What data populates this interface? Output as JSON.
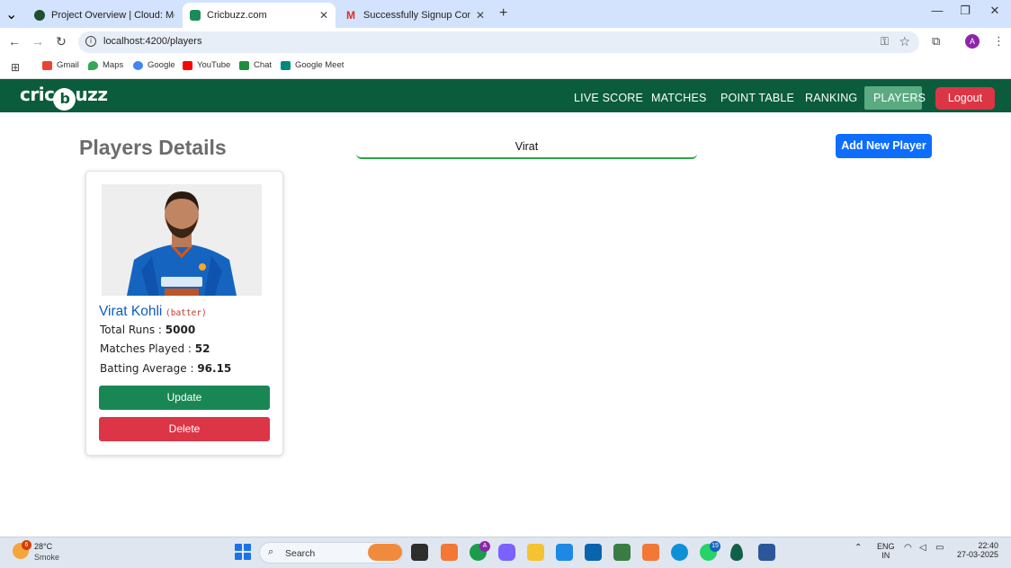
{
  "browser": {
    "tabs": [
      {
        "title": "Project Overview | Cloud: Mong",
        "favicon_color": "#1e4f2f"
      },
      {
        "title": "Cricbuzz.com",
        "favicon_color": "#1b8a5a"
      },
      {
        "title": "Successfully Signup Confirmatio",
        "favicon_color": "#d93025"
      }
    ],
    "url": "localhost:4200/players",
    "bookmarks": [
      "Gmail",
      "Maps",
      "Google",
      "YouTube",
      "Chat",
      "Google Meet"
    ],
    "profile_initial": "A"
  },
  "site": {
    "logo_prefix": "cric",
    "logo_ball": "b",
    "logo_suffix": "uzz",
    "nav": [
      "LIVE SCORE",
      "MATCHES",
      "POINT TABLE",
      "RANKING",
      "PLAYERS"
    ],
    "active_nav": "PLAYERS",
    "logout_label": "Logout",
    "brand_color": "#0b5c3d"
  },
  "page": {
    "title": "Players Details",
    "search_value": "Virat",
    "add_button": "Add New Player"
  },
  "player": {
    "name": "Virat Kohli",
    "role": "(batter)",
    "runs_label": "Total Runs : ",
    "runs_value": "5000",
    "matches_label": "Matches Played : ",
    "matches_value": "52",
    "average_label": "Batting Average : ",
    "average_value": "96.15",
    "update_label": "Update",
    "delete_label": "Delete"
  },
  "taskbar": {
    "weather_badge": "6",
    "temperature": "28°C",
    "condition": "Smoke",
    "search_label": "Search",
    "chrome_badge": "A",
    "whatsapp_badge": "15",
    "lang_top": "ENG",
    "lang_bottom": "IN",
    "time": "22:40",
    "date": "27-03-2025"
  }
}
